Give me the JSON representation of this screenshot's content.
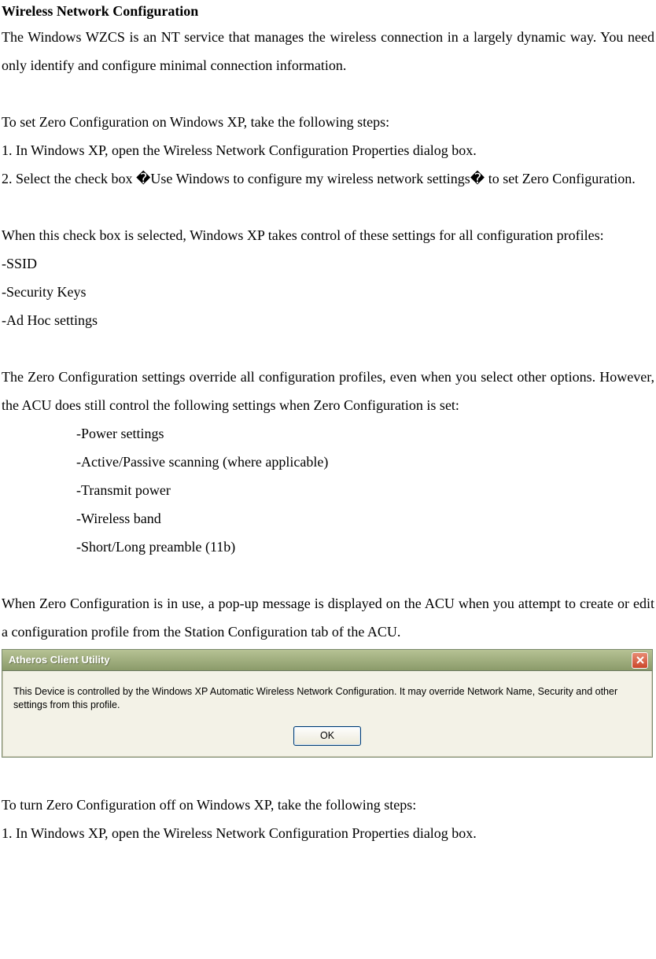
{
  "doc": {
    "title": "Wireless Network Configuration",
    "p1": "The Windows WZCS is an NT service that manages the wireless connection in a largely dynamic way. You need only identify and configure minimal connection information.",
    "p2": "To set Zero Configuration on Windows XP, take the following steps:",
    "step1": "1. In Windows XP, open the Wireless Network Configuration Properties dialog box.",
    "step2": "2. Select the check box �Use Windows to configure my wireless network settings� to set Zero Configuration.",
    "p3": "When this check box is selected, Windows XP takes control of these settings for all configuration profiles:",
    "listA": {
      "i1": "-SSID",
      "i2": "-Security Keys",
      "i3": "-Ad Hoc settings"
    },
    "p4": "The Zero Configuration settings override all configuration profiles, even when you select other options. However, the ACU does still control the following settings when Zero Configuration is set:",
    "listB": {
      "i1": "-Power settings",
      "i2": "-Active/Passive scanning (where applicable)",
      "i3": "-Transmit power",
      "i4": "-Wireless band",
      "i5": "-Short/Long preamble (11b)"
    },
    "p5": "When Zero Configuration is in use, a pop-up message is displayed on the ACU when you attempt to create or edit a configuration profile from the Station Configuration tab of the ACU.",
    "p6": "To turn Zero Configuration off on Windows XP, take the following steps:",
    "step1b": "1. In Windows XP, open the Wireless Network Configuration Properties dialog box."
  },
  "dialog": {
    "title": "Atheros Client Utility",
    "message": "This Device is controlled by the Windows XP Automatic Wireless Network Configuration. It may override Network Name, Security and other settings from this profile.",
    "ok": "OK"
  }
}
